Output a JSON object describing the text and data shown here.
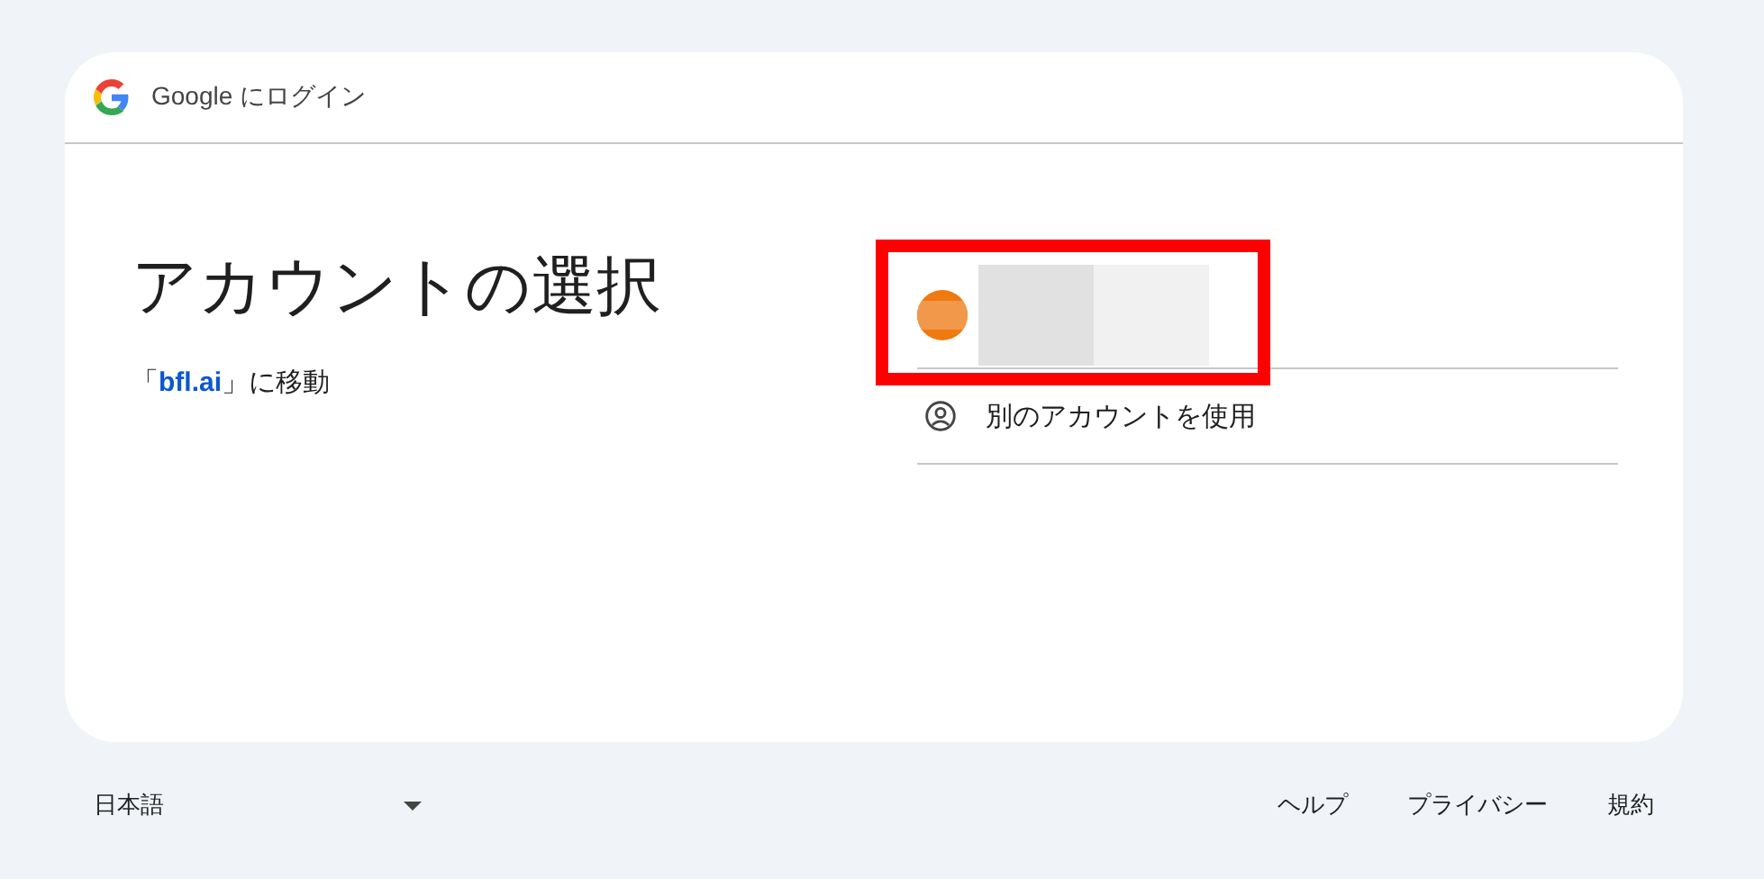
{
  "header": {
    "title": "Google にログイン"
  },
  "heading": "アカウントの選択",
  "continue_to": "「**bfl.ai**」に移動",
  "accounts": [
    {
      "kind": "redacted",
      "highlighted": true
    }
  ],
  "other_account": "別のアカウントを使用",
  "footer": {
    "language": "日本語",
    "links": [
      "ヘルプ",
      "プライバシー",
      "規約"
    ]
  }
}
